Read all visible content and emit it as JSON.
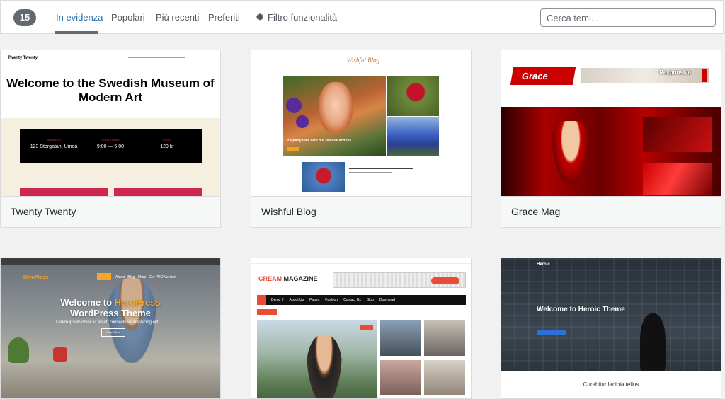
{
  "filter_bar": {
    "count": "15",
    "tabs": [
      {
        "label": "In evidenza",
        "active": true
      },
      {
        "label": "Popolari",
        "active": false
      },
      {
        "label": "Più recenti",
        "active": false
      },
      {
        "label": "Preferiti",
        "active": false
      }
    ],
    "feature_filter_label": "Filtro funzionalità",
    "search_placeholder": "Cerca temi..."
  },
  "themes": [
    {
      "name": "Twenty Twenty",
      "preview": {
        "site_title": "Twenty Twenty",
        "heading": "Welcome to the Swedish Museum of Modern Art",
        "info": [
          {
            "label": "ADDRESS",
            "value": "123 Storgatan, Umeå"
          },
          {
            "label": "OPEN TODAY",
            "value": "9:00 — 5:00"
          },
          {
            "label": "PRICE",
            "value": "129 kr"
          }
        ]
      }
    },
    {
      "name": "Wishful Blog",
      "preview": {
        "logo": "Wishful Blog",
        "caption": "It's party time with our famous actress"
      }
    },
    {
      "name": "Grace Mag",
      "preview": {
        "logo": "Grace",
        "banner": "Responsive"
      }
    },
    {
      "name": "HeroPress",
      "preview": {
        "brand": "HeroPress",
        "heading_1": "Welcome to",
        "heading_brand": "HeroPress",
        "heading_2": "WordPress Theme",
        "subtitle": "Lorem ipsum dolor sit amet, consectetur adipiscing elit.",
        "button": "Read More",
        "nav": [
          "About",
          "Blog",
          "Shop",
          "Get PRO Version"
        ]
      }
    },
    {
      "name": "Cream Magazine",
      "preview": {
        "logo_prefix": "CREAM",
        "logo_suffix": "MAGAZINE",
        "nav": [
          "Home",
          "Demo 2",
          "About Us",
          "Pages",
          "Fashion",
          "Contact Us",
          "Blog",
          "Download"
        ]
      }
    },
    {
      "name": "Heroic",
      "preview": {
        "brand": "Heroic",
        "heading": "Welcome to Heroic Theme",
        "footer_sub": "Curabitur lacinia tellus"
      }
    }
  ],
  "colors": {
    "accent": "#2271b1",
    "count_badge": "#646970"
  }
}
